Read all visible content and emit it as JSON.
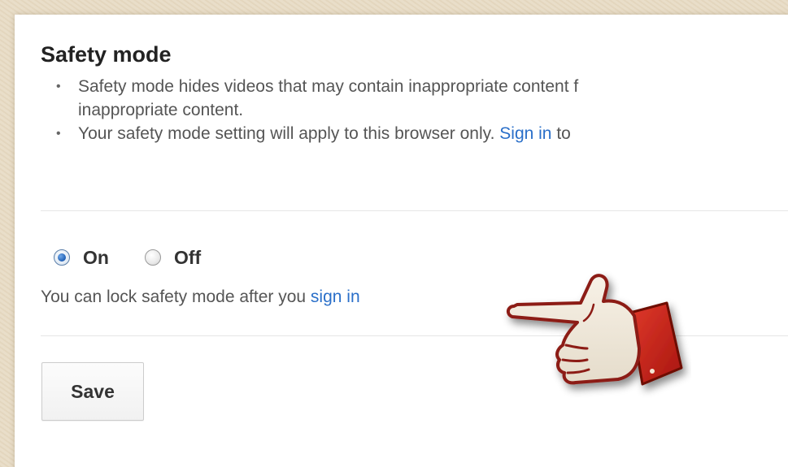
{
  "section": {
    "title": "Safety mode",
    "bullets": [
      {
        "line1": "Safety mode hides videos that may contain inappropriate content f",
        "line2": "inappropriate content."
      },
      {
        "text": "Your safety mode setting will apply to this browser only. ",
        "link": "Sign in",
        "after": " to"
      }
    ]
  },
  "safety_toggle": {
    "options": [
      {
        "label": "On",
        "selected": true
      },
      {
        "label": "Off",
        "selected": false
      }
    ]
  },
  "lock_note": {
    "text": "You can lock safety mode after you ",
    "link": "sign in"
  },
  "save_button": {
    "label": "Save"
  },
  "icons": {
    "bullet": "•",
    "pointer": "pointing-hand-icon"
  },
  "colors": {
    "link": "#2a6fc9",
    "radio_selected": "#1f5fb5",
    "hand_cuff": "#cc2a1e"
  }
}
